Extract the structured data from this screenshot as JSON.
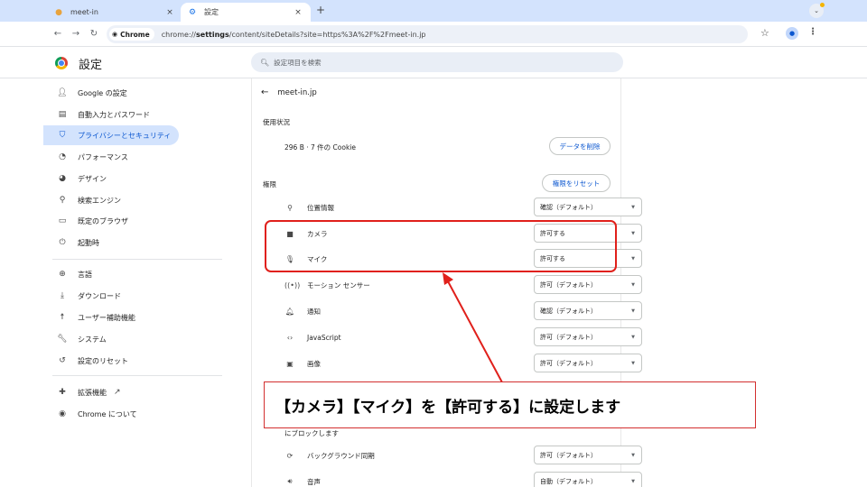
{
  "browser": {
    "tabs": [
      {
        "title": "meet-in",
        "close": "×"
      },
      {
        "title": "設定",
        "close": "×"
      }
    ],
    "new_tab": "+",
    "tab_menu": "⌄",
    "omnibox": {
      "chip": "Chrome",
      "url_prefix": "chrome://",
      "url_host": "settings",
      "url_rest": "/content/siteDetails?site=https%3A%2F%2Fmeet-in.jp"
    }
  },
  "settings": {
    "title": "設定",
    "search_placeholder": "設定項目を検索",
    "sidebar": [
      {
        "label": "Google の設定",
        "icon": "person-icon"
      },
      {
        "label": "自動入力とパスワード",
        "icon": "clipboard-icon"
      },
      {
        "label": "プライバシーとセキュリティ",
        "icon": "shield-icon",
        "active": true
      },
      {
        "label": "パフォーマンス",
        "icon": "speedometer-icon"
      },
      {
        "label": "デザイン",
        "icon": "palette-icon"
      },
      {
        "label": "検索エンジン",
        "icon": "search-icon"
      },
      {
        "label": "既定のブラウザ",
        "icon": "browser-icon"
      },
      {
        "label": "起動時",
        "icon": "power-icon"
      },
      {
        "label": "言語",
        "icon": "globe-icon"
      },
      {
        "label": "ダウンロード",
        "icon": "download-icon"
      },
      {
        "label": "ユーザー補助機能",
        "icon": "accessibility-icon"
      },
      {
        "label": "システム",
        "icon": "wrench-icon"
      },
      {
        "label": "設定のリセット",
        "icon": "history-icon"
      },
      {
        "label": "拡張機能",
        "icon": "puzzle-icon",
        "external": "↗"
      },
      {
        "label": "Chrome について",
        "icon": "chrome-icon"
      }
    ],
    "site": "meet-in.jp",
    "usage_label": "使用状況",
    "usage_text": "296 B · 7 件の Cookie",
    "delete_button": "データを削除",
    "permissions_label": "権限",
    "reset_button": "権限をリセット",
    "permissions": [
      {
        "label": "位置情報",
        "value": "確認（デフォルト）",
        "icon": "location-icon"
      },
      {
        "label": "カメラ",
        "value": "許可する",
        "icon": "camera-icon"
      },
      {
        "label": "マイク",
        "value": "許可する",
        "icon": "microphone-icon"
      },
      {
        "label": "モーション センサー",
        "value": "許可（デフォルト）",
        "icon": "motion-sensor-icon"
      },
      {
        "label": "通知",
        "value": "確認（デフォルト）",
        "icon": "bell-icon"
      },
      {
        "label": "JavaScript",
        "value": "許可（デフォルト）",
        "icon": "code-icon"
      },
      {
        "label": "画像",
        "value": "許可（デフォルト）",
        "icon": "image-icon"
      }
    ],
    "partial_text": "にブロックします",
    "permissions_bottom": [
      {
        "label": "バックグラウンド同期",
        "value": "許可（デフォルト）",
        "icon": "sync-icon"
      },
      {
        "label": "音声",
        "value": "自動（デフォルト）",
        "icon": "speaker-icon"
      }
    ]
  },
  "annotation": {
    "callout_text": "【カメラ】【マイク】を【許可する】に設定します",
    "color": "#e0201b"
  }
}
